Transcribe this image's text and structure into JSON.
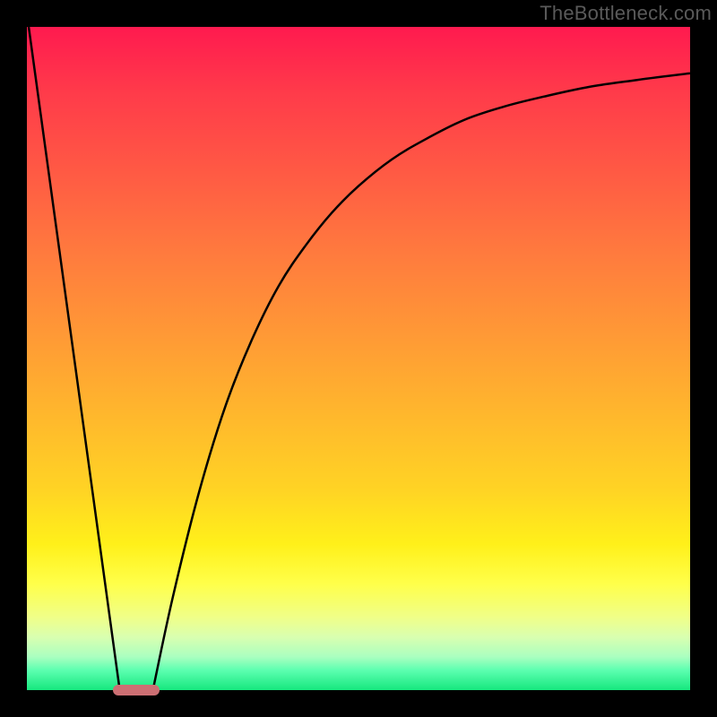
{
  "watermark": "TheBottleneck.com",
  "colors": {
    "frame_bg": "#000000",
    "gradient_top": "#ff1a4f",
    "gradient_bottom": "#16e77e",
    "curve_stroke": "#000000",
    "marker_fill": "#cc6f73"
  },
  "chart_data": {
    "type": "line",
    "title": "",
    "xlabel": "",
    "ylabel": "",
    "xlim": [
      0,
      100
    ],
    "ylim": [
      0,
      100
    ],
    "grid": false,
    "legend": false,
    "series": [
      {
        "name": "left-line",
        "x": [
          0,
          14
        ],
        "y": [
          102,
          0
        ]
      },
      {
        "name": "right-curve",
        "x": [
          19,
          22,
          26,
          30,
          34,
          38,
          42,
          46,
          50,
          55,
          60,
          66,
          72,
          78,
          85,
          92,
          100
        ],
        "y": [
          0,
          14,
          30,
          43,
          53,
          61,
          67,
          72,
          76,
          80,
          83,
          86,
          88,
          89.5,
          91,
          92,
          93
        ]
      }
    ],
    "marker": {
      "x_start": 13,
      "x_end": 20,
      "y": 0,
      "shape": "rounded-bar"
    },
    "background_gradient": {
      "orientation": "vertical",
      "stops": [
        {
          "pos": 0.0,
          "color": "#ff1a4f"
        },
        {
          "pos": 0.5,
          "color": "#ffb62d"
        },
        {
          "pos": 0.82,
          "color": "#ffff4a"
        },
        {
          "pos": 1.0,
          "color": "#16e77e"
        }
      ]
    }
  }
}
